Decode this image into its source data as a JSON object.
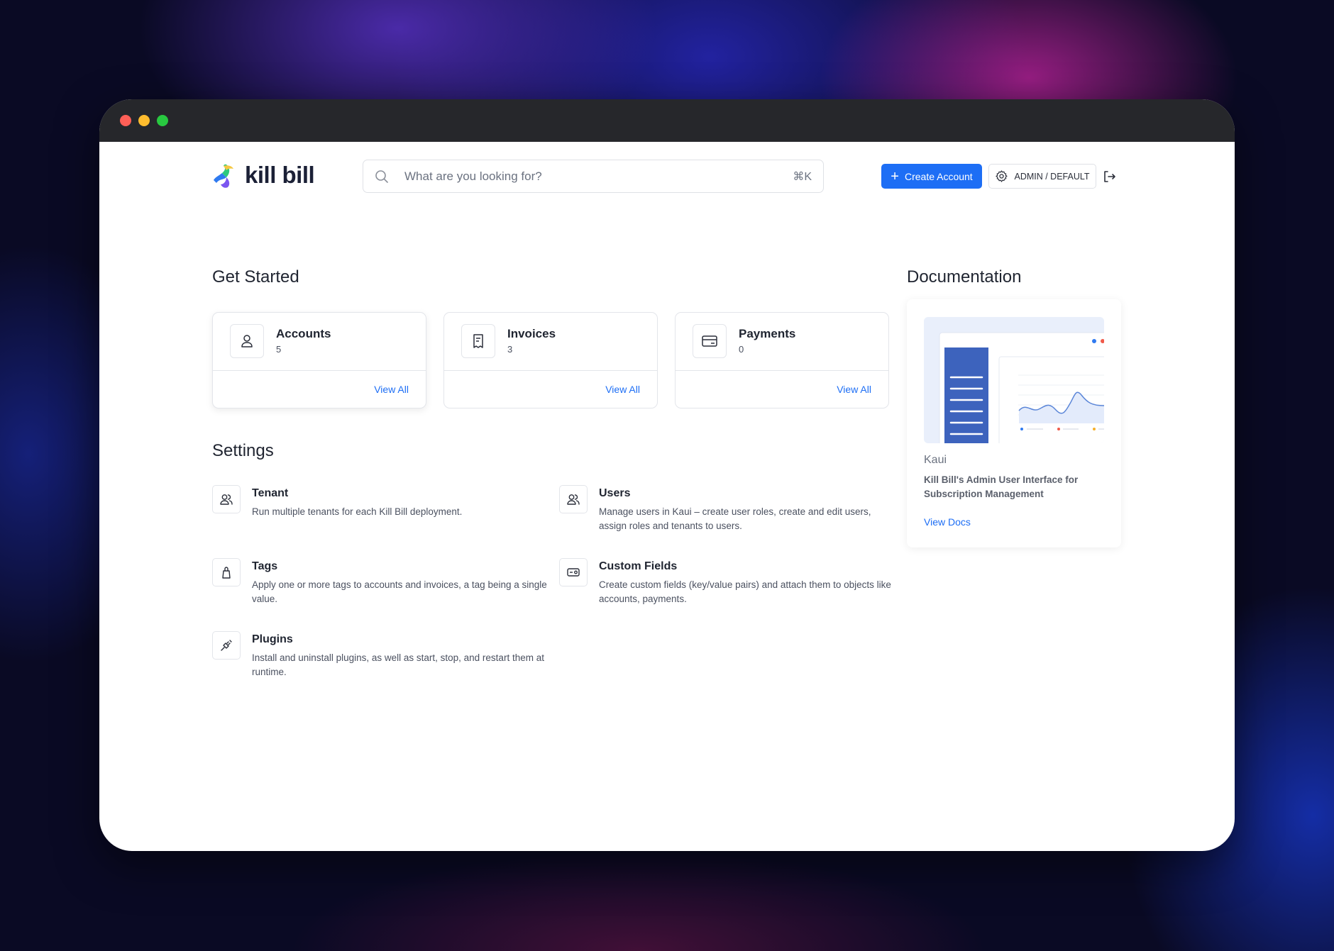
{
  "app": {
    "logo_text": "kill bill"
  },
  "search": {
    "placeholder": "What are you looking for?",
    "shortcut": "⌘K"
  },
  "header": {
    "create_account_label": "Create Account",
    "tenant_label": "ADMIN / DEFAULT"
  },
  "get_started": {
    "title": "Get Started",
    "cards": [
      {
        "title": "Accounts",
        "count": "5",
        "link": "View All",
        "icon": "user-icon"
      },
      {
        "title": "Invoices",
        "count": "3",
        "link": "View All",
        "icon": "receipt-icon"
      },
      {
        "title": "Payments",
        "count": "0",
        "link": "View All",
        "icon": "credit-card-icon"
      }
    ]
  },
  "settings": {
    "title": "Settings",
    "items": [
      {
        "title": "Tenant",
        "description": "Run multiple tenants for each Kill Bill deployment.",
        "icon": "users-icon"
      },
      {
        "title": "Users",
        "description": "Manage users in Kaui – create user roles, create and edit users, assign roles and tenants to users.",
        "icon": "users-icon"
      },
      {
        "title": "Tags",
        "description": "Apply one or more tags to accounts and invoices, a tag being a single value.",
        "icon": "tag-icon"
      },
      {
        "title": "Custom Fields",
        "description": "Create custom fields (key/value pairs) and attach them to objects like accounts, payments.",
        "icon": "custom-field-icon"
      },
      {
        "title": "Plugins",
        "description": "Install and uninstall plugins, as well as start, stop, and restart them at runtime.",
        "icon": "plug-icon"
      }
    ]
  },
  "documentation": {
    "title": "Documentation",
    "name": "Kaui",
    "description": "Kill Bill's Admin User Interface for Subscription Management",
    "link": "View Docs"
  },
  "colors": {
    "accent": "#1d6ef5",
    "text": "#1f2430",
    "muted": "#4b5160"
  }
}
